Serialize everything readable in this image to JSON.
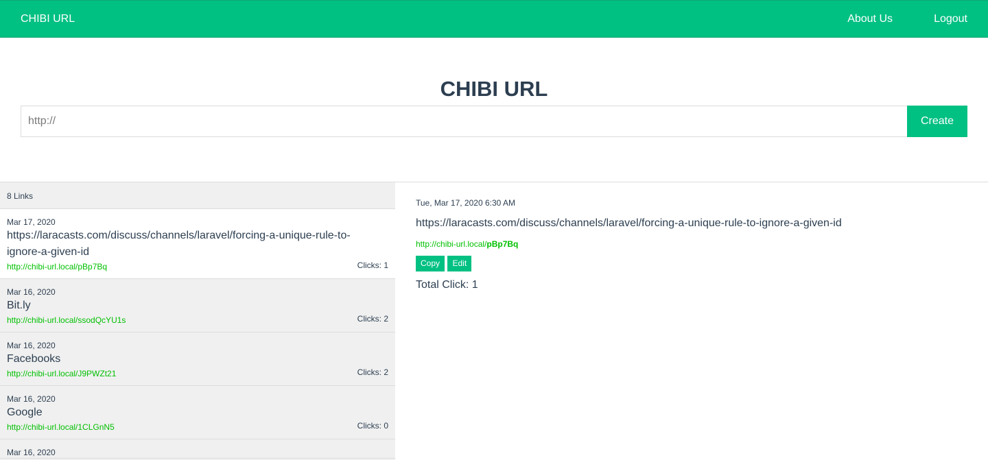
{
  "navbar": {
    "brand": "CHIBI URL",
    "about_label": "About Us",
    "logout_label": "Logout"
  },
  "hero": {
    "title": "CHIBI URL",
    "input_placeholder": "http://",
    "input_value": "",
    "create_label": "Create"
  },
  "sidebar": {
    "count_label": "8 Links",
    "items": [
      {
        "date": "Mar 17, 2020",
        "title": "https://laracasts.com/discuss/channels/laravel/forcing-a-unique-rule-to-ignore-a-given-id",
        "short_url": "http://chibi-url.local/pBp7Bq",
        "clicks": "Clicks: 1",
        "active": true
      },
      {
        "date": "Mar 16, 2020",
        "title": "Bit.ly",
        "short_url": "http://chibi-url.local/ssodQcYU1s",
        "clicks": "Clicks: 2"
      },
      {
        "date": "Mar 16, 2020",
        "title": "Facebooks",
        "short_url": "http://chibi-url.local/J9PWZt21",
        "clicks": "Clicks: 2"
      },
      {
        "date": "Mar 16, 2020",
        "title": "Google",
        "short_url": "http://chibi-url.local/1CLGnN5",
        "clicks": "Clicks: 0"
      },
      {
        "date": "Mar 16, 2020",
        "title": "",
        "short_url": "",
        "clicks": ""
      }
    ]
  },
  "detail": {
    "datetime": "Tue, Mar 17, 2020 6:30 AM",
    "original_url": "https://laracasts.com/discuss/channels/laravel/forcing-a-unique-rule-to-ignore-a-given-id",
    "short_prefix": "http://chibi-url.local/",
    "short_code": "pBp7Bq",
    "copy_label": "Copy",
    "edit_label": "Edit",
    "total_clicks": "Total Click: 1"
  }
}
